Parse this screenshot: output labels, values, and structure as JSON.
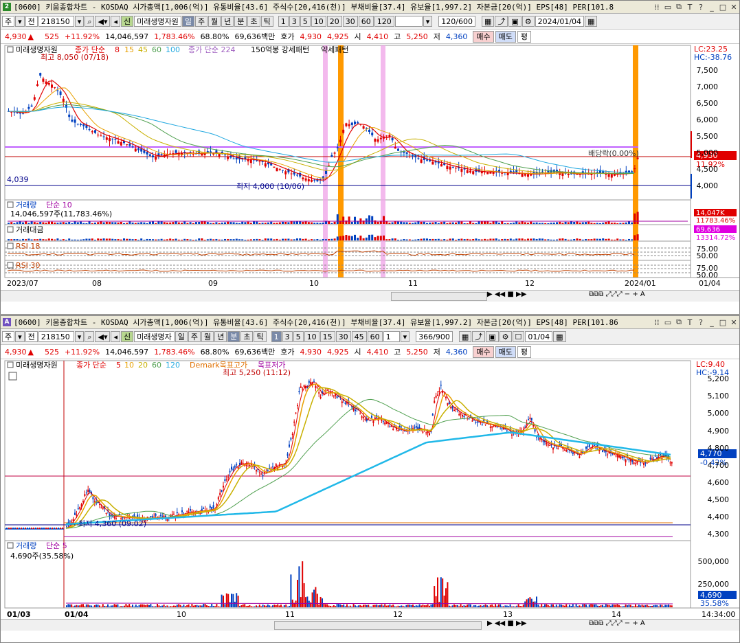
{
  "top": {
    "title_num": "2",
    "title": "[0600] 키움종합차트 - KOSDAQ 시가총액[1,006(억)] 유통비율[43.6] 주식수[20,416(천)] 부채비율[37.4] 유보율[1,997.2] 자본금[20(억)] EPS[48] PER[101.8",
    "toolbar": {
      "mode": "주",
      "prev": "전",
      "code": "218150",
      "name": "미래생명자원",
      "periods": [
        "일",
        "주",
        "월",
        "년",
        "분",
        "초",
        "틱"
      ],
      "nums": [
        "1",
        "3",
        "5",
        "10",
        "20",
        "30",
        "60",
        "120"
      ],
      "count": "120/600",
      "date": "2024/01/04"
    },
    "legend": {
      "name": "미래생명자원",
      "ma_label": "종가 단순",
      "ma_values": [
        "8",
        "15",
        "45",
        "60",
        "100"
      ],
      "ma2_label": "종가 단순 224",
      "pattern": "150억봉 강세패턴",
      "pattern2": "약세패턴"
    },
    "annotations": {
      "high": "최고 8,050 (07/18)",
      "low": "최저 4,000 (10/06)",
      "dividend": "배당락(0.00%)",
      "left_price": "4,039",
      "lc": "LC:23.25",
      "hc": "HC:-38.76",
      "price_tag": "4,930",
      "pct_tag": "11.92%"
    },
    "yticks": [
      "7,500",
      "7,000",
      "6,500",
      "6,000",
      "5,500",
      "5,000",
      "4,500",
      "4,000"
    ],
    "volume": {
      "label": "거래량",
      "ma": "단순 10",
      "value": "14,046,597주(11,783.46%)",
      "tag1": "14,047K",
      "tag2": "11783.46%"
    },
    "amount": {
      "label": "거래대금",
      "tag1": "69,636",
      "tag2": "13314.72%"
    },
    "rsi18": {
      "label": "RSI 18",
      "ticks": [
        "75.00",
        "50.00"
      ]
    },
    "rsi30": {
      "label": "RSI 30",
      "ticks": [
        "75.00",
        "50.00"
      ]
    },
    "xlabels": [
      "2023/07",
      "08",
      "09",
      "10",
      "11",
      "12",
      "2024/01",
      "01/04"
    ]
  },
  "bottom": {
    "title_num": "A",
    "title": "[0600] 키움종합차트 - KOSDAQ 시가총액[1,006(억)] 유통비율[43.6] 주식수[20,416(천)] 부채비율[37.4] 유보율[1,997.2] 자본금[20(억)] EPS[48] PER[101.86",
    "toolbar": {
      "mode": "주",
      "prev": "전",
      "code": "218150",
      "name": "미래생명자",
      "periods": [
        "일",
        "주",
        "월",
        "년",
        "분",
        "초",
        "틱"
      ],
      "nums": [
        "1",
        "3",
        "5",
        "10",
        "15",
        "30",
        "45",
        "60"
      ],
      "sel": "1",
      "count": "366/900",
      "date": "01/04"
    },
    "legend": {
      "name": "미래생명자원",
      "ma_label": "종가 단순",
      "ma_values": [
        "5",
        "10",
        "20",
        "60",
        "120"
      ],
      "demark": "Demark목표고가",
      "demark2": "목표저가"
    },
    "annotations": {
      "high": "최고 5,250 (11:12)",
      "low": "최저 4,360 (09:02)",
      "lc": "LC:9.40",
      "hc": "HC:-9.14",
      "price_tag": "4,770",
      "pct_tag": "-0.42%"
    },
    "yticks": [
      "5,200",
      "5,100",
      "5,000",
      "4,900",
      "4,800",
      "4,700",
      "4,600",
      "4,500",
      "4,400",
      "4,300"
    ],
    "volume": {
      "label": "거래량",
      "ma": "단순 5",
      "value": "4,690주(35.58%)",
      "tag1": "4,690",
      "tag2": "35.58%",
      "ticks": [
        "500,000",
        "250,000"
      ]
    },
    "xlabels": [
      "01/03",
      "01/04",
      "10",
      "11",
      "12",
      "13",
      "14",
      "14:34:00"
    ]
  },
  "quote": {
    "price": "4,930",
    "change": "525",
    "pct": "+11.92%",
    "volume": "14,046,597",
    "vol_pct": "1,783.46%",
    "turnover": "68.80%",
    "amount": "69,636백만",
    "label_hoga": "호가",
    "ask": "4,930",
    "bid": "4,925",
    "label_open": "시",
    "open": "4,410",
    "label_high": "고",
    "high": "5,250",
    "label_low": "저",
    "low": "4,360",
    "buy": "매수",
    "sell": "매도",
    "eval": "평"
  },
  "colors": {
    "up": "#e00000",
    "down": "#0040c0",
    "orange": "#ff9900",
    "pink": "#f0a8e8"
  }
}
